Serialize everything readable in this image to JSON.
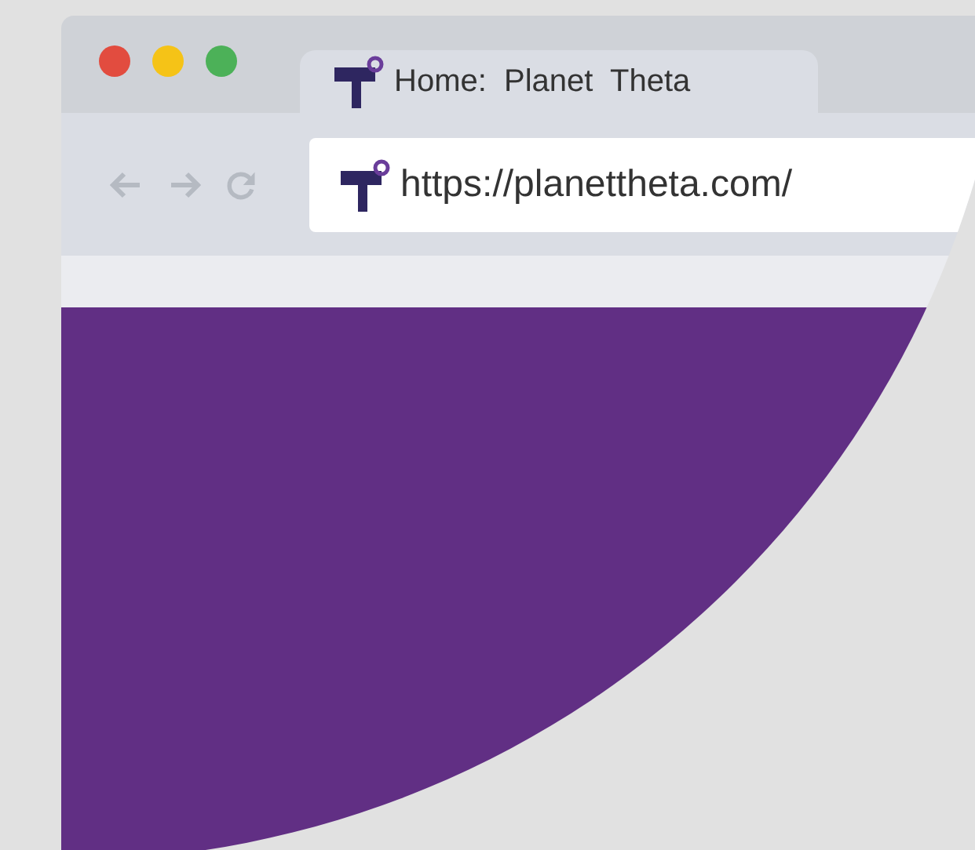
{
  "window_controls": [
    {
      "color": "#e24c3f"
    },
    {
      "color": "#f5c317"
    },
    {
      "color": "#4cb158"
    }
  ],
  "tab": {
    "title": "Home:  Planet  Theta"
  },
  "address_bar": {
    "url": "https://planettheta.com/"
  }
}
